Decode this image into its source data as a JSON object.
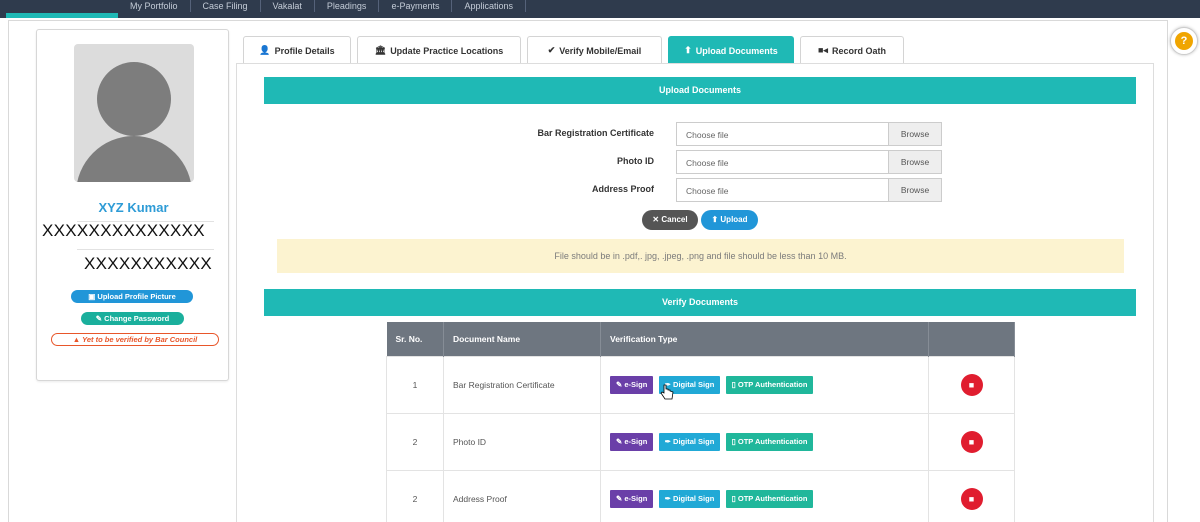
{
  "topnav": {
    "items": [
      "My Portfolio",
      "Case Filing",
      "Vakalat",
      "Pleadings",
      "e-Payments",
      "Applications"
    ]
  },
  "profile": {
    "name": "XYZ Kumar",
    "masked_line1": "XXXXXXXXXXXXXX",
    "masked_line2": "XXXXXXXXXXX",
    "upload_picture_label": "Upload Profile Picture",
    "change_password_label": "Change Password",
    "verification_status": "Yet to be verified by Bar Council"
  },
  "tabs": [
    {
      "label": "Profile Details",
      "icon": "user-icon",
      "active": false
    },
    {
      "label": "Update Practice Locations",
      "icon": "bank-icon",
      "active": false
    },
    {
      "label": "Verify Mobile/Email",
      "icon": "check-icon",
      "active": false
    },
    {
      "label": "Upload Documents",
      "icon": "upload-icon",
      "active": true
    },
    {
      "label": "Record Oath",
      "icon": "video-icon",
      "active": false
    }
  ],
  "upload": {
    "title": "Upload Documents",
    "fields": [
      {
        "label": "Bar Registration Certificate",
        "placeholder": "Choose file",
        "browse": "Browse"
      },
      {
        "label": "Photo ID",
        "placeholder": "Choose file",
        "browse": "Browse"
      },
      {
        "label": "Address Proof",
        "placeholder": "Choose file",
        "browse": "Browse"
      }
    ],
    "cancel_label": "Cancel",
    "upload_label": "Upload",
    "notice": "File should be in .pdf,. jpg, .jpeg, .png and file should be less than 10 MB."
  },
  "verify": {
    "title": "Verify Documents",
    "columns": [
      "Sr. No.",
      "Document Name",
      "Verification Type",
      ""
    ],
    "esign_label": "e-Sign",
    "dsign_label": "Digital Sign",
    "otp_label": "OTP Authentication",
    "rows": [
      {
        "sr": "1",
        "name": "Bar Registration Certificate"
      },
      {
        "sr": "2",
        "name": "Photo ID"
      },
      {
        "sr": "2",
        "name": "Address Proof"
      }
    ]
  },
  "colors": {
    "accent": "#1fb9b5",
    "nav": "#2f3b4d",
    "esign": "#6a3fa8",
    "dsign": "#21a9d6",
    "otp": "#20b79b",
    "delete": "#e01d2f",
    "warning": "#e8562a"
  }
}
